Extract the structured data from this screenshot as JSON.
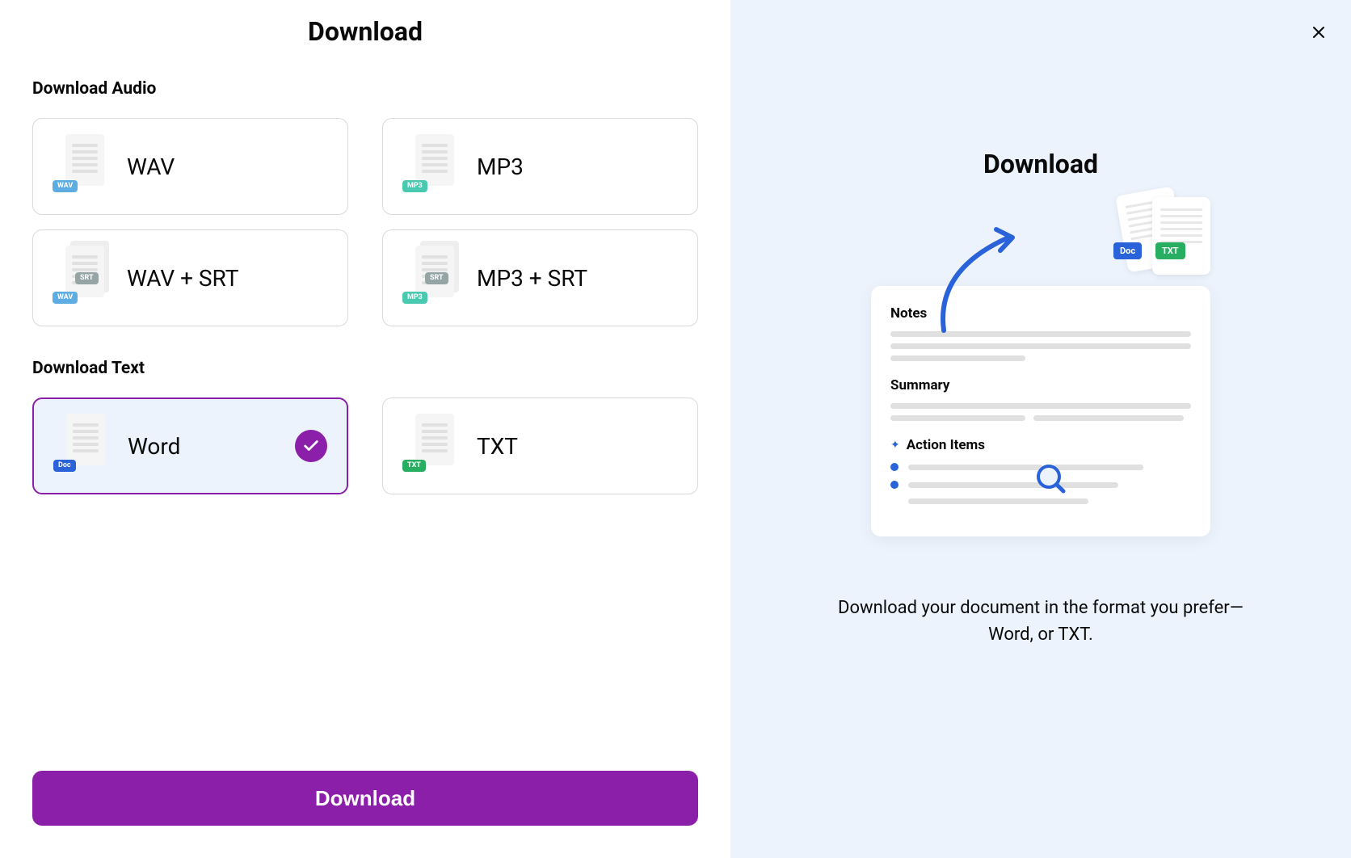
{
  "left": {
    "title": "Download",
    "audio_section": "Download Audio",
    "text_section": "Download Text",
    "options": {
      "wav": {
        "label": "WAV",
        "badge": "WAV"
      },
      "mp3": {
        "label": "MP3",
        "badge": "MP3"
      },
      "wav_srt": {
        "label": "WAV + SRT",
        "badge1": "WAV",
        "badge2": "SRT"
      },
      "mp3_srt": {
        "label": "MP3 + SRT",
        "badge1": "MP3",
        "badge2": "SRT"
      },
      "word": {
        "label": "Word",
        "badge": "Doc",
        "selected": true
      },
      "txt": {
        "label": "TXT",
        "badge": "TXT"
      }
    },
    "download_button": "Download"
  },
  "right": {
    "title": "Download",
    "illustration": {
      "doc_badge": "Doc",
      "txt_badge": "TXT",
      "notes_title": "Notes",
      "summary_title": "Summary",
      "action_items_title": "Action Items"
    },
    "description": "Download your document in the format you prefer—Word, or TXT."
  }
}
